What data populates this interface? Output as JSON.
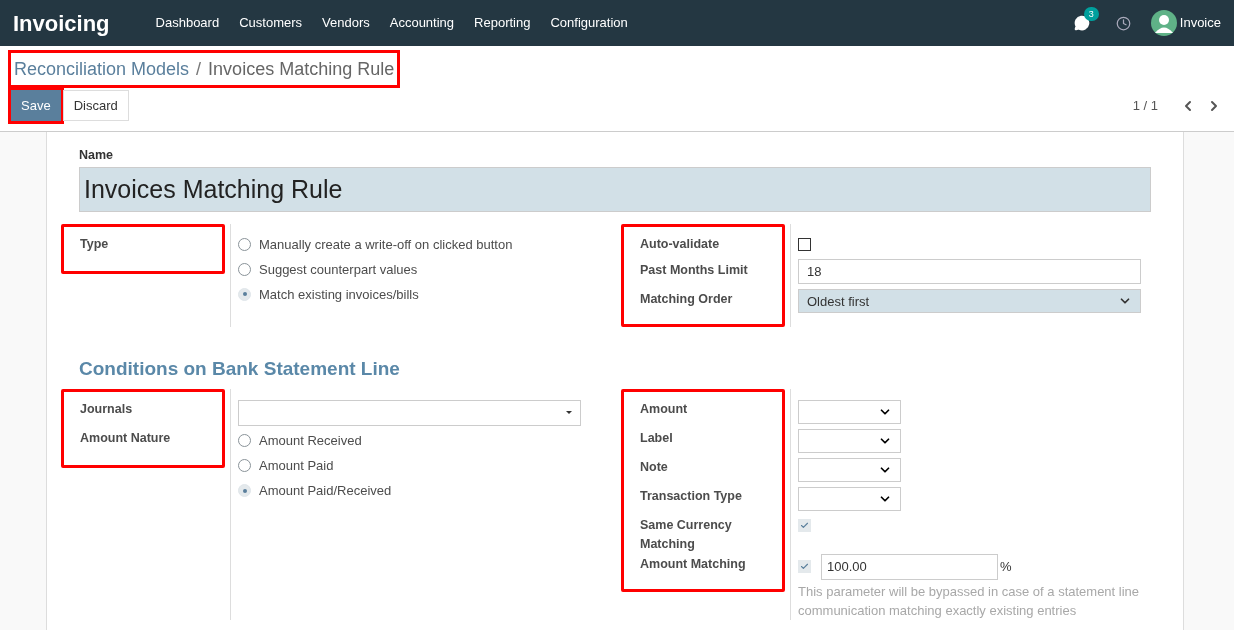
{
  "navbar": {
    "app_name": "Invoicing",
    "menu": [
      "Dashboard",
      "Customers",
      "Vendors",
      "Accounting",
      "Reporting",
      "Configuration"
    ],
    "chat_count": "3",
    "user": "Invoice"
  },
  "breadcrumb": {
    "highlighted": true,
    "items": [
      "Reconciliation Models",
      "Invoices Matching Rule"
    ],
    "separator": "/"
  },
  "buttons": [
    {
      "label": "Save",
      "kind": "primary",
      "highlighted": true
    },
    {
      "label": "Discard",
      "kind": "secondary",
      "highlighted": false
    }
  ],
  "pager": "1 / 1",
  "form": {
    "name_label": "Name",
    "name_value": "Invoices Matching Rule",
    "top_groups": [
      {
        "highlighted": true,
        "rows": [
          {
            "label": "Type",
            "kind": "radio",
            "options": [
              {
                "label": "Manually create a write-off on clicked button",
                "selected": false
              },
              {
                "label": "Suggest counterpart values",
                "selected": false
              },
              {
                "label": "Match existing invoices/bills",
                "selected": true
              }
            ]
          }
        ]
      },
      {
        "highlighted": true,
        "rows": [
          {
            "label": "Auto-validate",
            "kind": "checkbox",
            "checked": false
          },
          {
            "label": "Past Months Limit",
            "kind": "input",
            "value": "18"
          },
          {
            "label": "Matching Order",
            "kind": "select",
            "value": "Oldest first"
          }
        ]
      }
    ],
    "section_title": "Conditions on Bank Statement Line",
    "bottom_groups": [
      {
        "highlighted": true,
        "rows": [
          {
            "label": "Journals",
            "kind": "many2one"
          },
          {
            "label": "Amount Nature",
            "kind": "radio",
            "options": [
              {
                "label": "Amount Received",
                "selected": false
              },
              {
                "label": "Amount Paid",
                "selected": false
              },
              {
                "label": "Amount Paid/Received",
                "selected": true
              }
            ]
          }
        ]
      },
      {
        "highlighted": true,
        "rows": [
          {
            "label": "Amount",
            "kind": "small_select"
          },
          {
            "label": "Label",
            "kind": "small_select"
          },
          {
            "label": "Note",
            "kind": "small_select"
          },
          {
            "label": "Transaction Type",
            "kind": "small_select"
          },
          {
            "label": "Same Currency Matching",
            "kind": "checkbox",
            "checked": true
          },
          {
            "label": "Amount Matching",
            "kind": "checkbox_input",
            "checked": true,
            "value": "100.00",
            "suffix": "%",
            "help": "This parameter will be bypassed in case of a statement line communication matching exactly existing entries"
          }
        ]
      }
    ]
  }
}
